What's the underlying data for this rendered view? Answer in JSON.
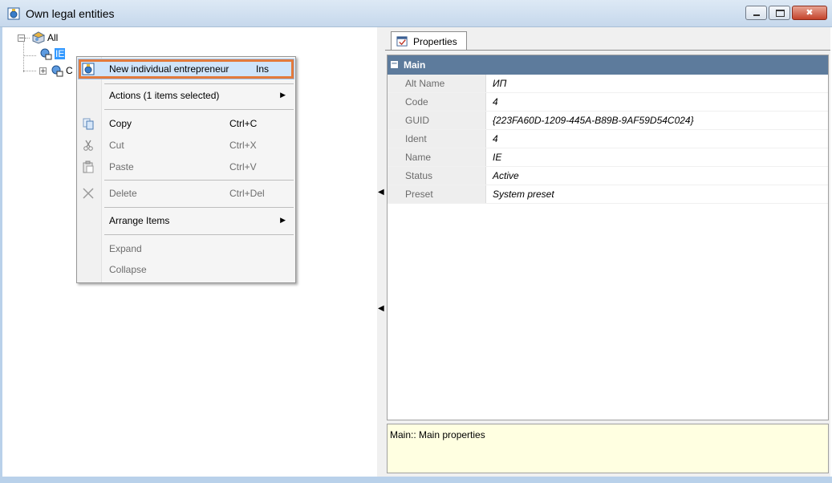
{
  "window": {
    "title": "Own legal entities"
  },
  "tree": {
    "root_label": "All",
    "child_label": "IE",
    "second_child_label": "C"
  },
  "context_menu": {
    "items": [
      {
        "label": "New individual entrepreneur",
        "shortcut": "Ins",
        "icon": "entity-icon"
      },
      {
        "label": "Actions (1 items selected)",
        "submenu": true
      },
      {
        "label": "Copy",
        "shortcut": "Ctrl+C",
        "icon": "copy-icon"
      },
      {
        "label": "Cut",
        "shortcut": "Ctrl+X",
        "icon": "cut-icon"
      },
      {
        "label": "Paste",
        "shortcut": "Ctrl+V",
        "icon": "paste-icon"
      },
      {
        "label": "Delete",
        "shortcut": "Ctrl+Del",
        "icon": "delete-icon"
      },
      {
        "label": "Arrange Items",
        "submenu": true
      },
      {
        "label": "Expand"
      },
      {
        "label": "Collapse"
      }
    ]
  },
  "properties": {
    "tab_label": "Properties",
    "category": "Main",
    "rows": [
      {
        "name": "Alt Name",
        "value": "ИП"
      },
      {
        "name": "Code",
        "value": "4"
      },
      {
        "name": "GUID",
        "value": "{223FA60D-1209-445A-B89B-9AF59D54C024}"
      },
      {
        "name": "Ident",
        "value": "4"
      },
      {
        "name": "Name",
        "value": "IE"
      },
      {
        "name": "Status",
        "value": "Active"
      },
      {
        "name": "Preset",
        "value": "System preset"
      }
    ],
    "description": "Main:: Main properties"
  },
  "colors": {
    "selection": "#3399ff",
    "highlight_border": "#e37a3c",
    "category_bar": "#5d7b9c",
    "description_bg": "#ffffe1"
  }
}
